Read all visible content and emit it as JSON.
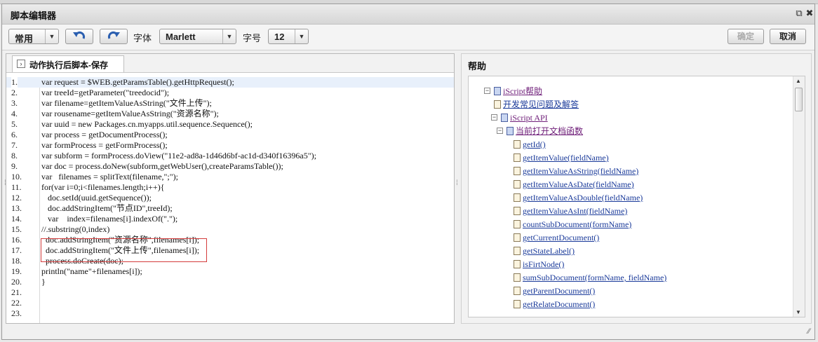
{
  "window": {
    "title": "脚本编辑器"
  },
  "toolbar": {
    "mode": "常用",
    "font_label": "字体",
    "font_value": "Marlett",
    "size_label": "字号",
    "size_value": "12",
    "confirm": "确定",
    "cancel": "取消"
  },
  "editor": {
    "tab_label": "动作执行后脚本-保存",
    "lines": [
      {
        "n": "1.",
        "code": "var request = $WEB.getParamsTable().getHttpRequest();"
      },
      {
        "n": "2.",
        "code": "var treeId=getParameter(\"treedocid\");"
      },
      {
        "n": "3.",
        "code": "var filename=getItemValueAsString(\"文件上传\");"
      },
      {
        "n": "4.",
        "code": "var rousename=getItemValueAsString(\"资源名称\");"
      },
      {
        "n": "5.",
        "code": "var uuid = new Packages.cn.myapps.util.sequence.Sequence();"
      },
      {
        "n": "6.",
        "code": "var process = getDocumentProcess();"
      },
      {
        "n": "7.",
        "code": "var formProcess = getFormProcess();"
      },
      {
        "n": "8.",
        "code": "var subform = formProcess.doView(\"11e2-ad8a-1d46d6bf-ac1d-d340f16396a5\");"
      },
      {
        "n": "9.",
        "code": "var doc = process.doNew(subform,getWebUser(),createParamsTable());"
      },
      {
        "n": "10.",
        "code": "var   filenames = splitText(filename,\";\");"
      },
      {
        "n": "11.",
        "code": "for(var i=0;i<filenames.length;i++){"
      },
      {
        "n": "12.",
        "code": "   doc.setId(uuid.getSequence());"
      },
      {
        "n": "13.",
        "code": "   doc.addStringItem(\"节点ID\",treeId);"
      },
      {
        "n": "14.",
        "code": "   var    index=filenames[i].indexOf(\".\");"
      },
      {
        "n": "15.",
        "code": "//.substring(0,index)"
      },
      {
        "n": "16.",
        "code": "  doc.addStringItem(\"资源名称\",filenames[i]);"
      },
      {
        "n": "17.",
        "code": "  doc.addStringItem(\"文件上传\",filenames[i]);"
      },
      {
        "n": "18.",
        "code": "  process.doCreate(doc);"
      },
      {
        "n": "19.",
        "code": "println(\"name\"+filenames[i]);"
      },
      {
        "n": "20.",
        "code": "}"
      },
      {
        "n": "21.",
        "code": ""
      },
      {
        "n": "22.",
        "code": ""
      },
      {
        "n": "23.",
        "code": ""
      }
    ]
  },
  "help": {
    "title": "帮助",
    "tree": [
      {
        "label": "iScript帮助",
        "icon": "book",
        "exp": "−",
        "visited": true
      },
      {
        "label": "开发常见问题及解答",
        "icon": "page",
        "exp": "",
        "visited": false
      },
      {
        "label": "iScript API",
        "icon": "book",
        "exp": "−",
        "visited": true
      },
      {
        "label": "当前打开文档函数",
        "icon": "book",
        "exp": "−",
        "visited": true
      },
      {
        "label": "getId()",
        "icon": "page",
        "exp": "",
        "visited": false
      },
      {
        "label": "getItemValue(fieldName)",
        "icon": "page",
        "exp": "",
        "visited": false
      },
      {
        "label": "getItemValueAsString(fieldName)",
        "icon": "page",
        "exp": "",
        "visited": false
      },
      {
        "label": "getItemValueAsDate(fieldName)",
        "icon": "page",
        "exp": "",
        "visited": false
      },
      {
        "label": "getItemValueAsDouble(fieldName)",
        "icon": "page",
        "exp": "",
        "visited": false
      },
      {
        "label": "getItemValueAsInt(fieldName)",
        "icon": "page",
        "exp": "",
        "visited": false
      },
      {
        "label": "countSubDocument(formName)",
        "icon": "page",
        "exp": "",
        "visited": false
      },
      {
        "label": "getCurrentDocument()",
        "icon": "page",
        "exp": "",
        "visited": false
      },
      {
        "label": "getStateLabel()",
        "icon": "page",
        "exp": "",
        "visited": false
      },
      {
        "label": "isFirtNode()",
        "icon": "page",
        "exp": "",
        "visited": false
      },
      {
        "label": "sumSubDocument(formName, fieldName)",
        "icon": "page",
        "exp": "",
        "visited": false
      },
      {
        "label": "getParentDocument()",
        "icon": "page",
        "exp": "",
        "visited": false
      },
      {
        "label": "getRelateDocument()",
        "icon": "page",
        "exp": "",
        "visited": false
      }
    ]
  }
}
